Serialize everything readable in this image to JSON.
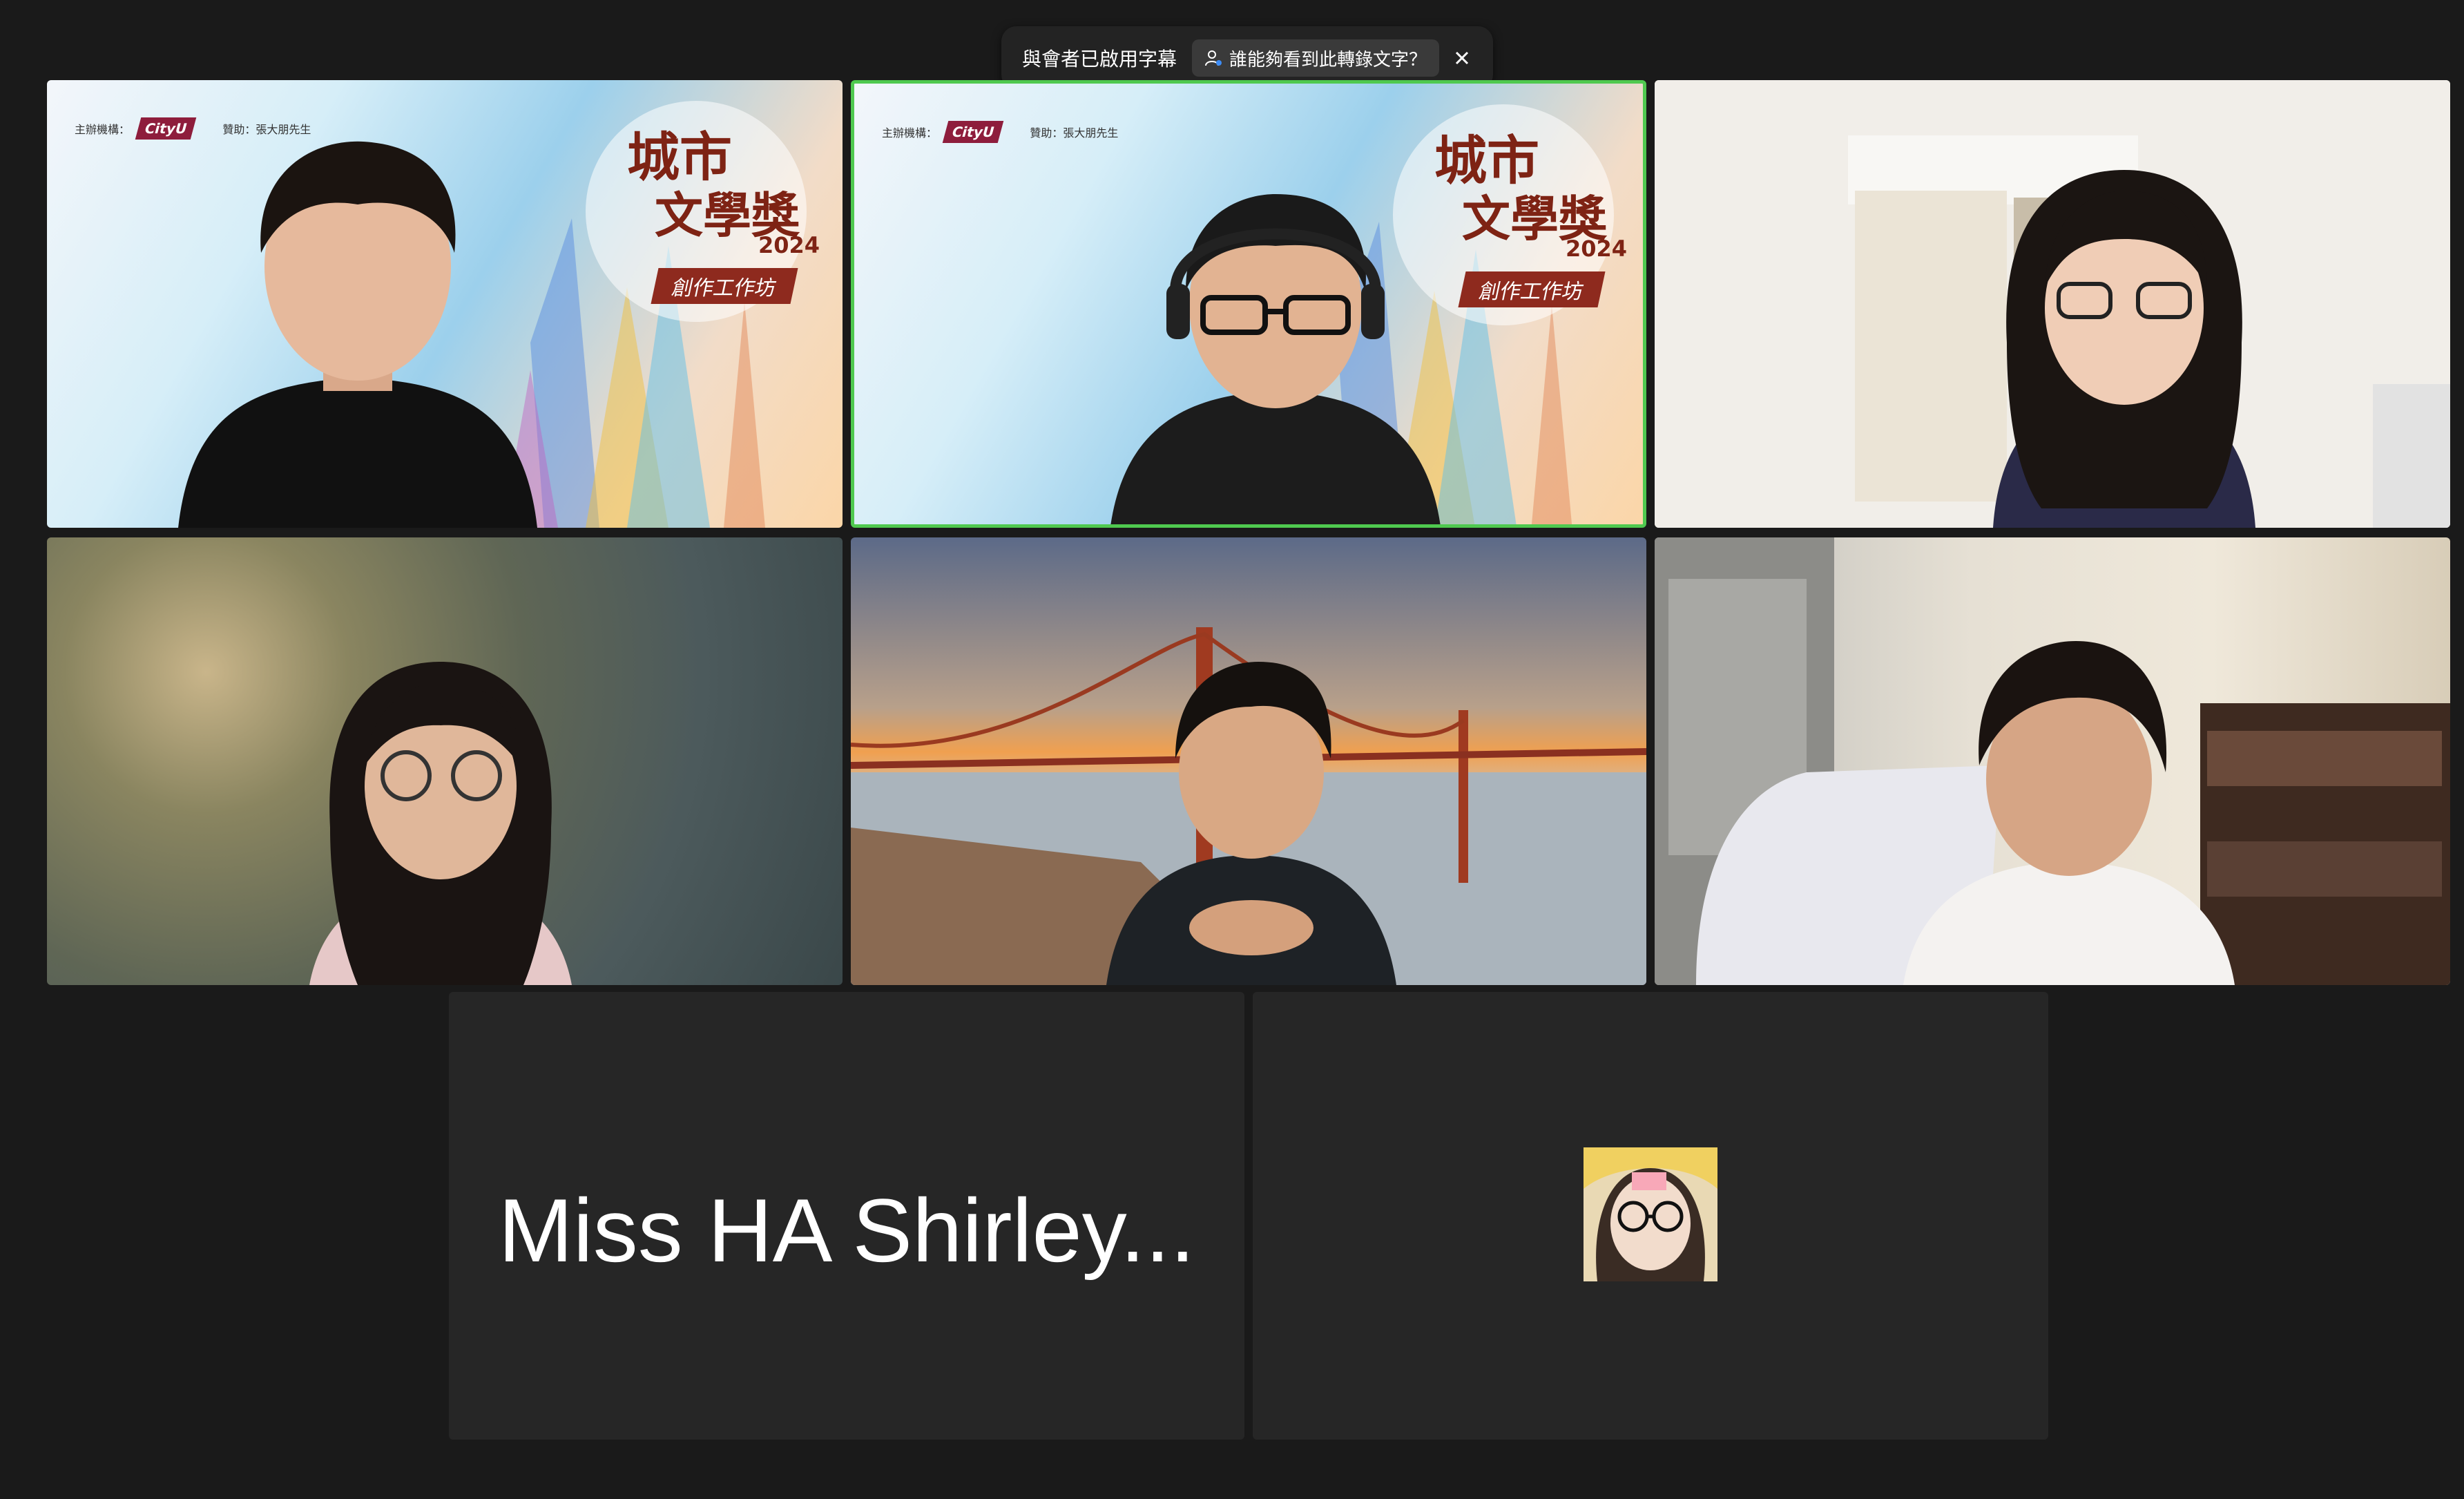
{
  "banner": {
    "caption_status": "與會者已啟用字幕",
    "who_can_see_label": "誰能夠看到此轉錄文字？",
    "close_icon": "close-icon",
    "person_icon": "person-icon"
  },
  "conference_background": {
    "organizer_label": "主辦機構：",
    "organizer_logo": "CityU",
    "sponsor_label": "贊助：張大朋先生",
    "award_title_line1": "城市",
    "award_title_line2": "文學獎",
    "award_year": "2024",
    "award_ribbon": "創作工作坊"
  },
  "participants": [
    {
      "tile": "speaker-1",
      "video": true,
      "background": "conference"
    },
    {
      "tile": "speaker-2",
      "video": true,
      "background": "conference",
      "active_speaker": true
    },
    {
      "tile": "participant-3",
      "video": true,
      "background": "room"
    },
    {
      "tile": "participant-4",
      "video": true,
      "background": "blurred"
    },
    {
      "tile": "participant-5",
      "video": true,
      "background": "golden-gate-bridge"
    },
    {
      "tile": "participant-6",
      "video": true,
      "background": "room"
    },
    {
      "tile": "participant-7",
      "video": false,
      "display_name": "Miss HA Shirley..."
    },
    {
      "tile": "participant-8",
      "video": false,
      "avatar": "profile-picture"
    }
  ],
  "colors": {
    "background": "#1a1a1a",
    "tile_off": "#262626",
    "active_border": "#4fc94f"
  }
}
